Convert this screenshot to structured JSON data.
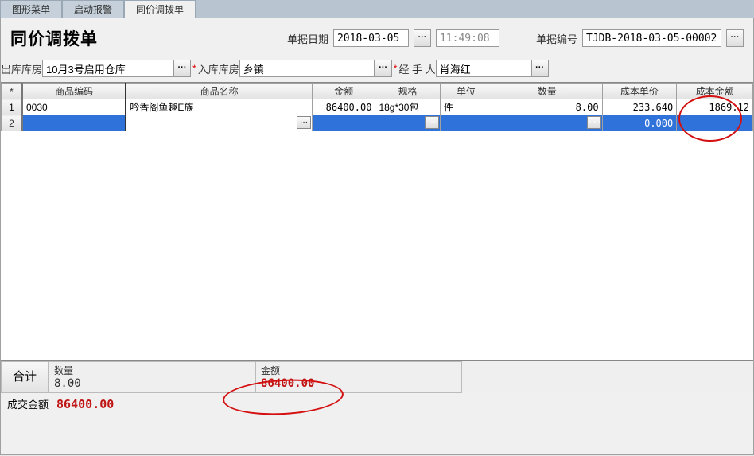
{
  "tabs": [
    "图形菜单",
    "启动报警",
    "同价调拨单"
  ],
  "page_title": "同价调拨单",
  "header": {
    "date_label": "单据日期",
    "date_value": "2018-03-05",
    "time_value": "11:49:08",
    "docno_label": "单据编号",
    "docno_value": "TJDB-2018-03-05-00002"
  },
  "warehouse": {
    "out_label": "出库库房",
    "out_value": "10月3号启用仓库",
    "in_label": "入库库房",
    "in_value": "乡镇",
    "handler_label": "经  手  人",
    "handler_value": "肖海红"
  },
  "grid": {
    "columns": [
      "*",
      "商品编码",
      "商品名称",
      "金额",
      "规格",
      "单位",
      "数量",
      "成本单价",
      "成本金额"
    ],
    "rows": [
      {
        "idx": "1",
        "code": "0030",
        "name": "吟香阁鱼趣E族",
        "amount": "86400.00",
        "spec": "18g*30包",
        "unit": "件",
        "qty": "8.00",
        "cost_price": "233.640",
        "cost_amount": "1869.12"
      },
      {
        "idx": "2",
        "code": "",
        "name": "",
        "amount": "",
        "spec": "",
        "unit": "",
        "qty": "",
        "cost_price": "0.000",
        "cost_amount": ""
      }
    ]
  },
  "summary": {
    "label": "合计",
    "qty_label": "数量",
    "qty_value": "8.00",
    "amount_label": "金额",
    "amount_value": "86400.00"
  },
  "deal": {
    "label": "成交金额",
    "value": "86400.00"
  },
  "ellipsis": "···"
}
